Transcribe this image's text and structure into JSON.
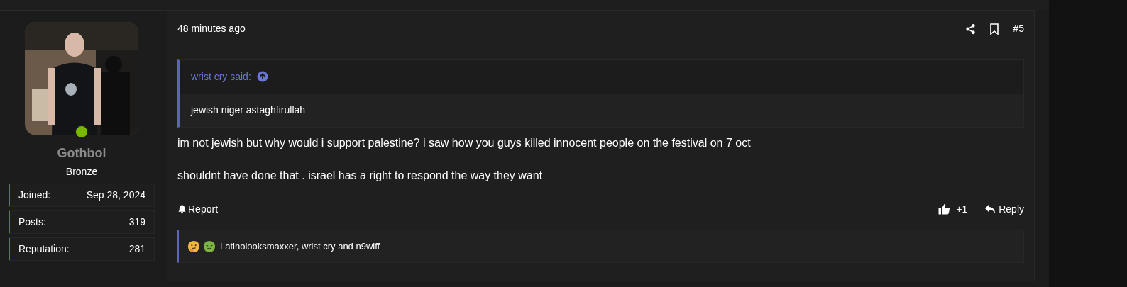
{
  "user": {
    "name": "Gothboi",
    "rank": "Bronze",
    "online": true,
    "stats": [
      {
        "label": "Joined:",
        "value": "Sep 28, 2024"
      },
      {
        "label": "Posts:",
        "value": "319"
      },
      {
        "label": "Reputation:",
        "value": "281"
      }
    ]
  },
  "post": {
    "time": "48 minutes ago",
    "number": "#5",
    "quote": {
      "author": "wrist cry said:",
      "text": "jewish niger astaghfirullah"
    },
    "paragraphs": [
      "im not jewish but why would i support palestine? i saw how you guys killed innocent people on the festival on 7 oct",
      "shouldnt have done that . israel has a right to respond the way they want"
    ],
    "report": "Report",
    "like_count": "+1",
    "reply": "Reply",
    "reactions": {
      "emojis": [
        {
          "kind": "thinking"
        },
        {
          "kind": "nauseated"
        }
      ],
      "text": "Latinolooksmaxxer, wrist cry and n9wiff"
    }
  }
}
